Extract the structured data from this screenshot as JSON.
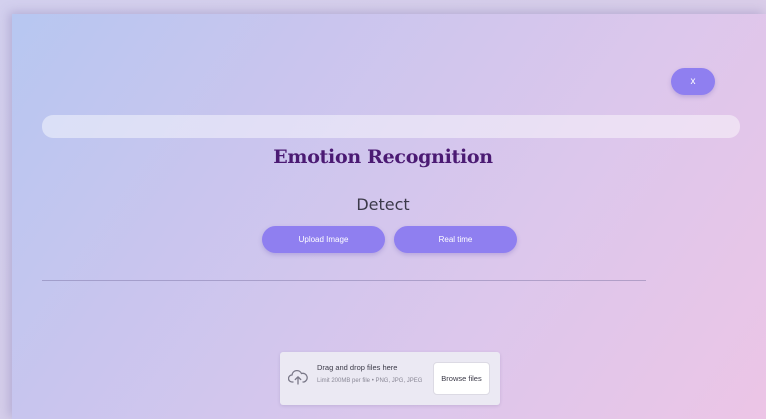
{
  "header": {
    "close_label": "x"
  },
  "main": {
    "title": "Emotion Recognition",
    "subtitle": "Detect",
    "buttons": {
      "upload_label": "Upload Image",
      "realtime_label": "Real time"
    }
  },
  "uploader": {
    "primary_text": "Drag and drop files here",
    "secondary_text": "Limit 200MB per file • PNG, JPG, JPEG",
    "browse_label": "Browse files",
    "icon": "cloud-upload-icon"
  },
  "colors": {
    "accent": "#8f7ff0",
    "title": "#4b1a73"
  }
}
